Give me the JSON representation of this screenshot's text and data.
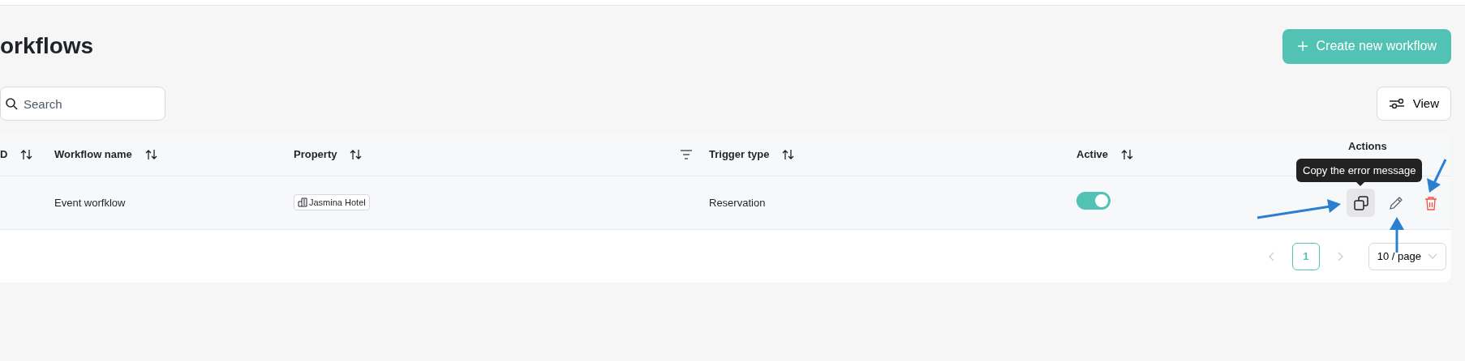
{
  "page": {
    "title": "orkflows"
  },
  "create_button": {
    "label": "Create new workflow"
  },
  "search": {
    "placeholder": "Search"
  },
  "view_button": {
    "label": "View"
  },
  "table": {
    "columns": [
      {
        "label": "D",
        "sortable": true,
        "filter": false
      },
      {
        "label": "Workflow name",
        "sortable": true,
        "filter": false
      },
      {
        "label": "Property",
        "sortable": true,
        "filter": true
      },
      {
        "label": "Trigger type",
        "sortable": true,
        "filter": false
      },
      {
        "label": "Active",
        "sortable": true,
        "filter": false
      },
      {
        "label": "Actions",
        "sortable": false,
        "filter": false
      }
    ],
    "rows": [
      {
        "workflow_name": "Event worfklow",
        "property": "Jasmina Hotel",
        "trigger_type": "Reservation",
        "active": true,
        "actions": [
          {
            "kind": "copy",
            "hovered": true
          },
          {
            "kind": "edit",
            "hovered": false
          },
          {
            "kind": "delete",
            "hovered": false
          }
        ]
      }
    ]
  },
  "tooltip": {
    "text": "Copy the error message"
  },
  "pagination": {
    "pages": [
      {
        "label": "1",
        "selected": true
      }
    ],
    "page_size": "10 / page"
  }
}
